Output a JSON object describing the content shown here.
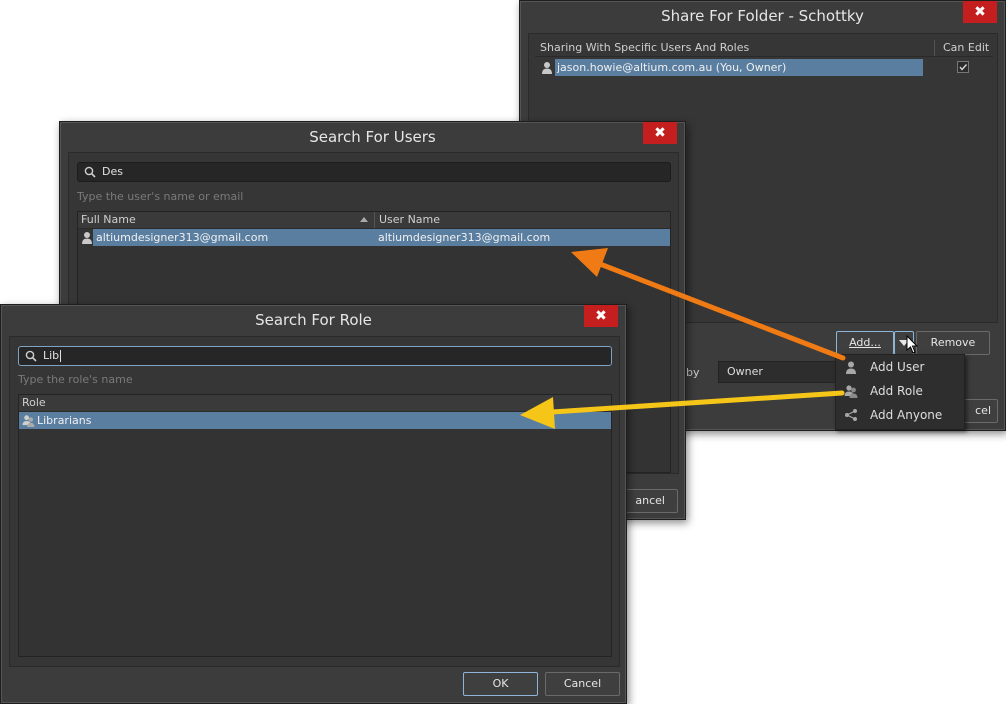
{
  "share_dialog": {
    "title": "Share For Folder - Schottky",
    "close": "✖",
    "col_sharing": "Sharing With Specific Users And Roles",
    "col_can_edit": "Can Edit",
    "row_user": "jason.howie@altium.com.au (You, Owner)",
    "add_button": "Add...",
    "remove_button": "Remove",
    "by_label": "by",
    "owner_value": "Owner",
    "cancel_partial": "cel"
  },
  "add_menu": {
    "items": [
      {
        "label": "Add User",
        "icon": "user-icon"
      },
      {
        "label": "Add Role",
        "icon": "role-icon"
      },
      {
        "label": "Add Anyone",
        "icon": "share-icon"
      }
    ]
  },
  "users_dialog": {
    "title": "Search For Users",
    "close": "✖",
    "search_value": "Des",
    "hint": "Type the user's name or email",
    "col_full_name": "Full Name",
    "col_user_name": "User Name",
    "row_full_name": "altiumdesigner313@gmail.com",
    "row_user_name": "altiumdesigner313@gmail.com",
    "cancel_partial": "ancel"
  },
  "role_dialog": {
    "title": "Search For Role",
    "close": "✖",
    "search_value": "Lib",
    "hint": "Type the role's name",
    "col_role": "Role",
    "row_role": "Librarians",
    "ok": "OK",
    "cancel": "Cancel"
  },
  "colors": {
    "arrow_orange": "#f07a14",
    "arrow_yellow": "#f5c518",
    "selection": "#5a7ea0"
  }
}
